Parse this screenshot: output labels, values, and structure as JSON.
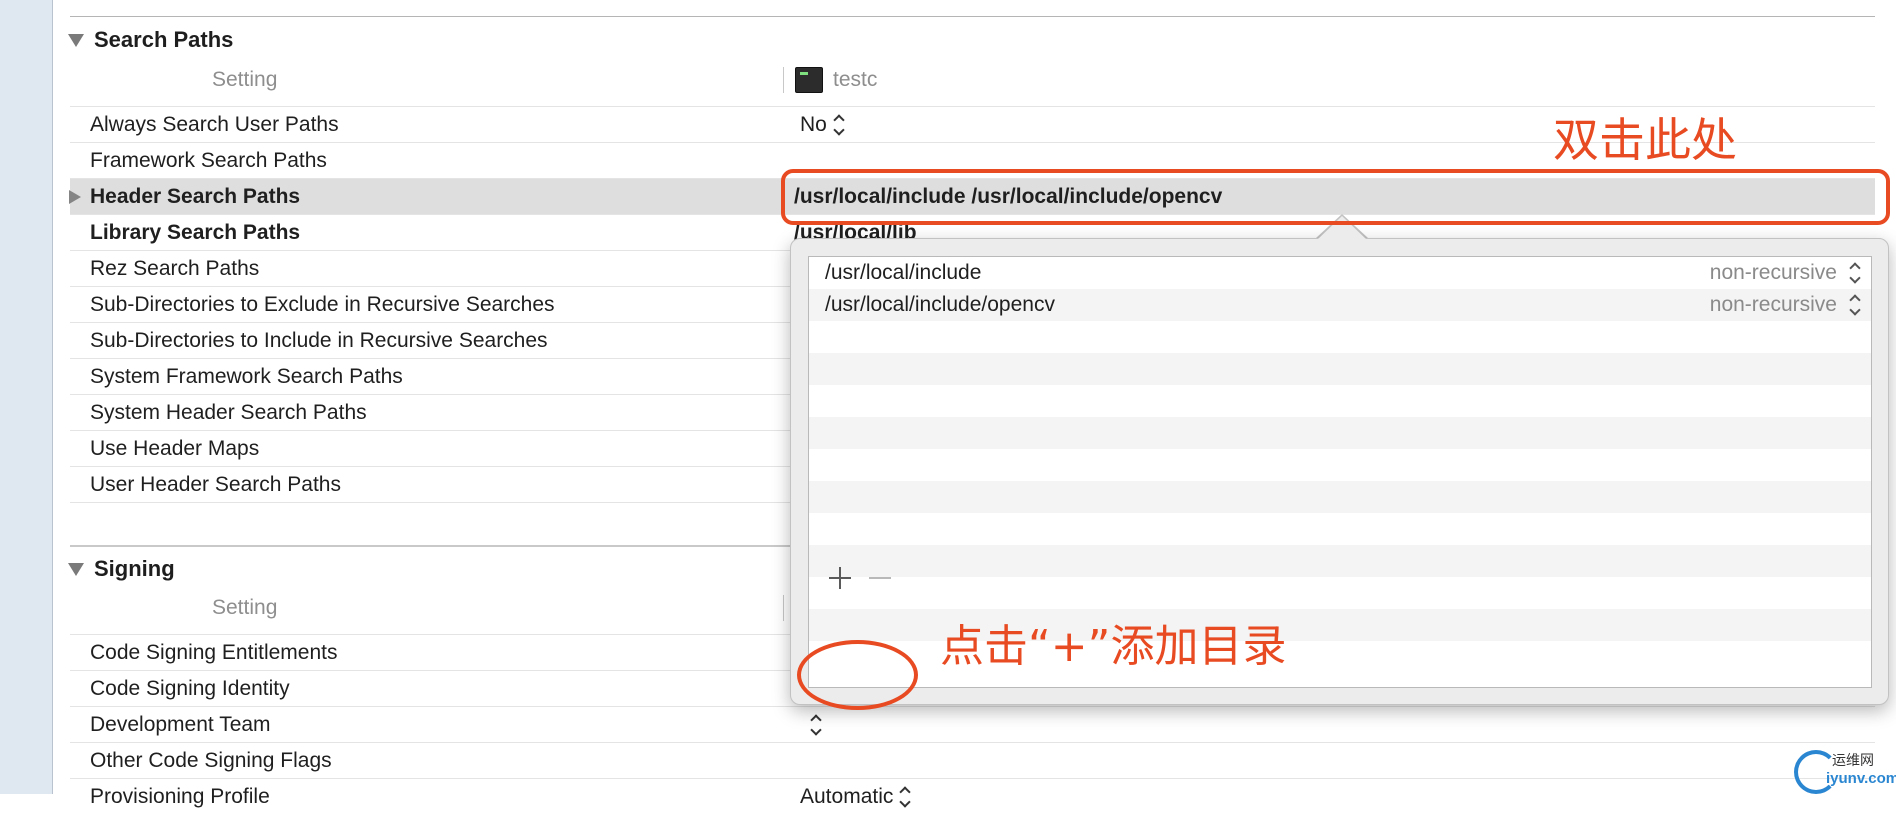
{
  "search_paths": {
    "section_title": "Search Paths",
    "column_setting": "Setting",
    "column_target": "testc",
    "rows": [
      {
        "name": "Always Search User Paths",
        "value": "No"
      },
      {
        "name": "Framework Search Paths",
        "value": ""
      },
      {
        "name": "Header Search Paths",
        "value": "/usr/local/include /usr/local/include/opencv"
      },
      {
        "name": "Library Search Paths",
        "value": "/usr/local/lib"
      },
      {
        "name": "Rez Search Paths",
        "value": ""
      },
      {
        "name": "Sub-Directories to Exclude in Recursive Searches",
        "value": ""
      },
      {
        "name": "Sub-Directories to Include in Recursive Searches",
        "value": ""
      },
      {
        "name": "System Framework Search Paths",
        "value": ""
      },
      {
        "name": "System Header Search Paths",
        "value": ""
      },
      {
        "name": "Use Header Maps",
        "value": ""
      },
      {
        "name": "User Header Search Paths",
        "value": ""
      }
    ]
  },
  "popover": {
    "paths": [
      {
        "path": "/usr/local/include",
        "mode": "non-recursive"
      },
      {
        "path": "/usr/local/include/opencv",
        "mode": "non-recursive"
      }
    ],
    "add_label": "+",
    "remove_label": "−"
  },
  "signing": {
    "section_title": "Signing",
    "column_setting": "Setting",
    "rows": [
      {
        "name": "Code Signing Entitlements",
        "value": ""
      },
      {
        "name": "Code Signing Identity",
        "value": ""
      },
      {
        "name": "Development Team",
        "value": ""
      },
      {
        "name": "Other Code Signing Flags",
        "value": ""
      },
      {
        "name": "Provisioning Profile",
        "value": "Automatic"
      }
    ]
  },
  "annotations": {
    "double_click_here": "双击此处",
    "click_plus_add_dir": "点击“+”添加目录"
  },
  "watermark": {
    "cn": "运维网",
    "en": "iyunv.com"
  },
  "colors": {
    "annotation": "#e84a22",
    "selected_row": "#dedede",
    "watermark": "#2a86d1"
  }
}
